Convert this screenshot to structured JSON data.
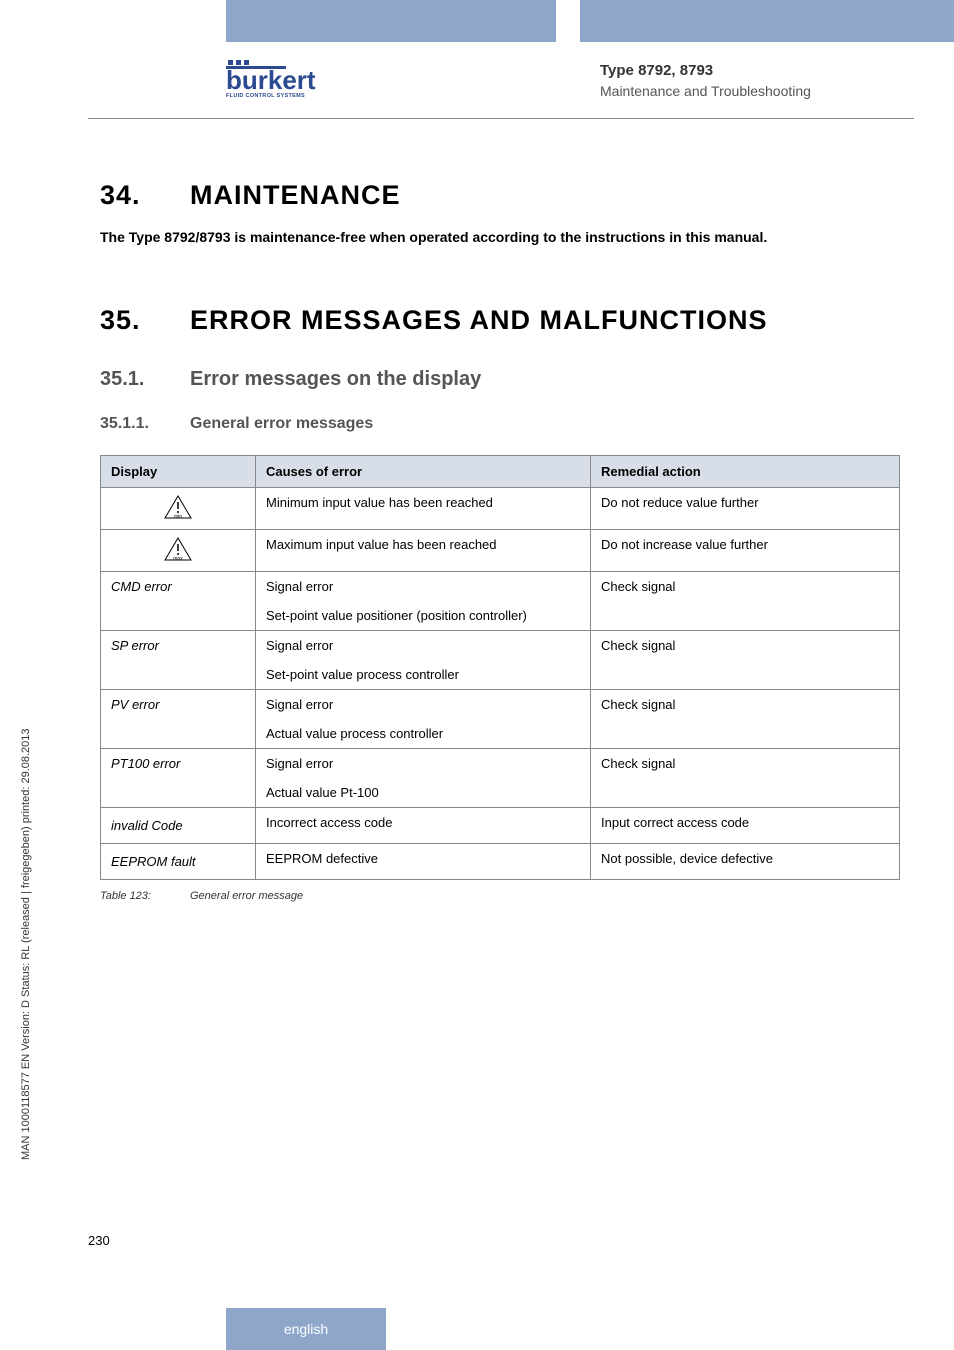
{
  "logo": {
    "name": "burkert",
    "tagline": "FLUID CONTROL SYSTEMS"
  },
  "header": {
    "type_line": "Type 8792, 8793",
    "subtitle": "Maintenance and Troubleshooting"
  },
  "sec34": {
    "num": "34.",
    "title": "MAINTENANCE",
    "intro": "The Type 8792/8793 is maintenance-free when operated according to the instructions in this manual."
  },
  "sec35": {
    "num": "35.",
    "title": "ERROR MESSAGES AND MALFUNCTIONS",
    "sub1": {
      "num": "35.1.",
      "title": "Error messages on the display"
    },
    "sub11": {
      "num": "35.1.1.",
      "title": "General error messages"
    }
  },
  "table": {
    "headers": {
      "display": "Display",
      "cause": "Causes of error",
      "remedy": "Remedial action"
    },
    "rows": [
      {
        "display_icon": "min",
        "cause": "Minimum input value has been reached",
        "remedy": "Do not reduce value further"
      },
      {
        "display_icon": "max",
        "cause": "Maximum input value has been reached",
        "remedy": "Do not increase value further"
      },
      {
        "display": "CMD error",
        "cause1": "Signal error",
        "cause2": "Set-point value positioner (position controller)",
        "remedy": "Check signal"
      },
      {
        "display": "SP error",
        "cause1": "Signal error",
        "cause2": "Set-point value  process controller",
        "remedy": "Check signal"
      },
      {
        "display": "PV error",
        "cause1": "Signal error",
        "cause2": "Actual value  process controller",
        "remedy": "Check signal"
      },
      {
        "display": "PT100 error",
        "cause1": "Signal error",
        "cause2": "Actual value  Pt-100",
        "remedy": "Check signal"
      },
      {
        "display": "invalid Code",
        "cause": "Incorrect access code",
        "remedy": "Input correct access code"
      },
      {
        "display": "EEPROM fault",
        "cause": "EEPROM defective",
        "remedy": "Not possible, device defective"
      }
    ],
    "caption_label": "Table 123:",
    "caption_text": "General error message"
  },
  "side_text": "MAN  1000118577  EN  Version: D  Status: RL (released | freigegeben)  printed: 29.08.2013",
  "page_number": "230",
  "footer": {
    "lang": "english"
  }
}
